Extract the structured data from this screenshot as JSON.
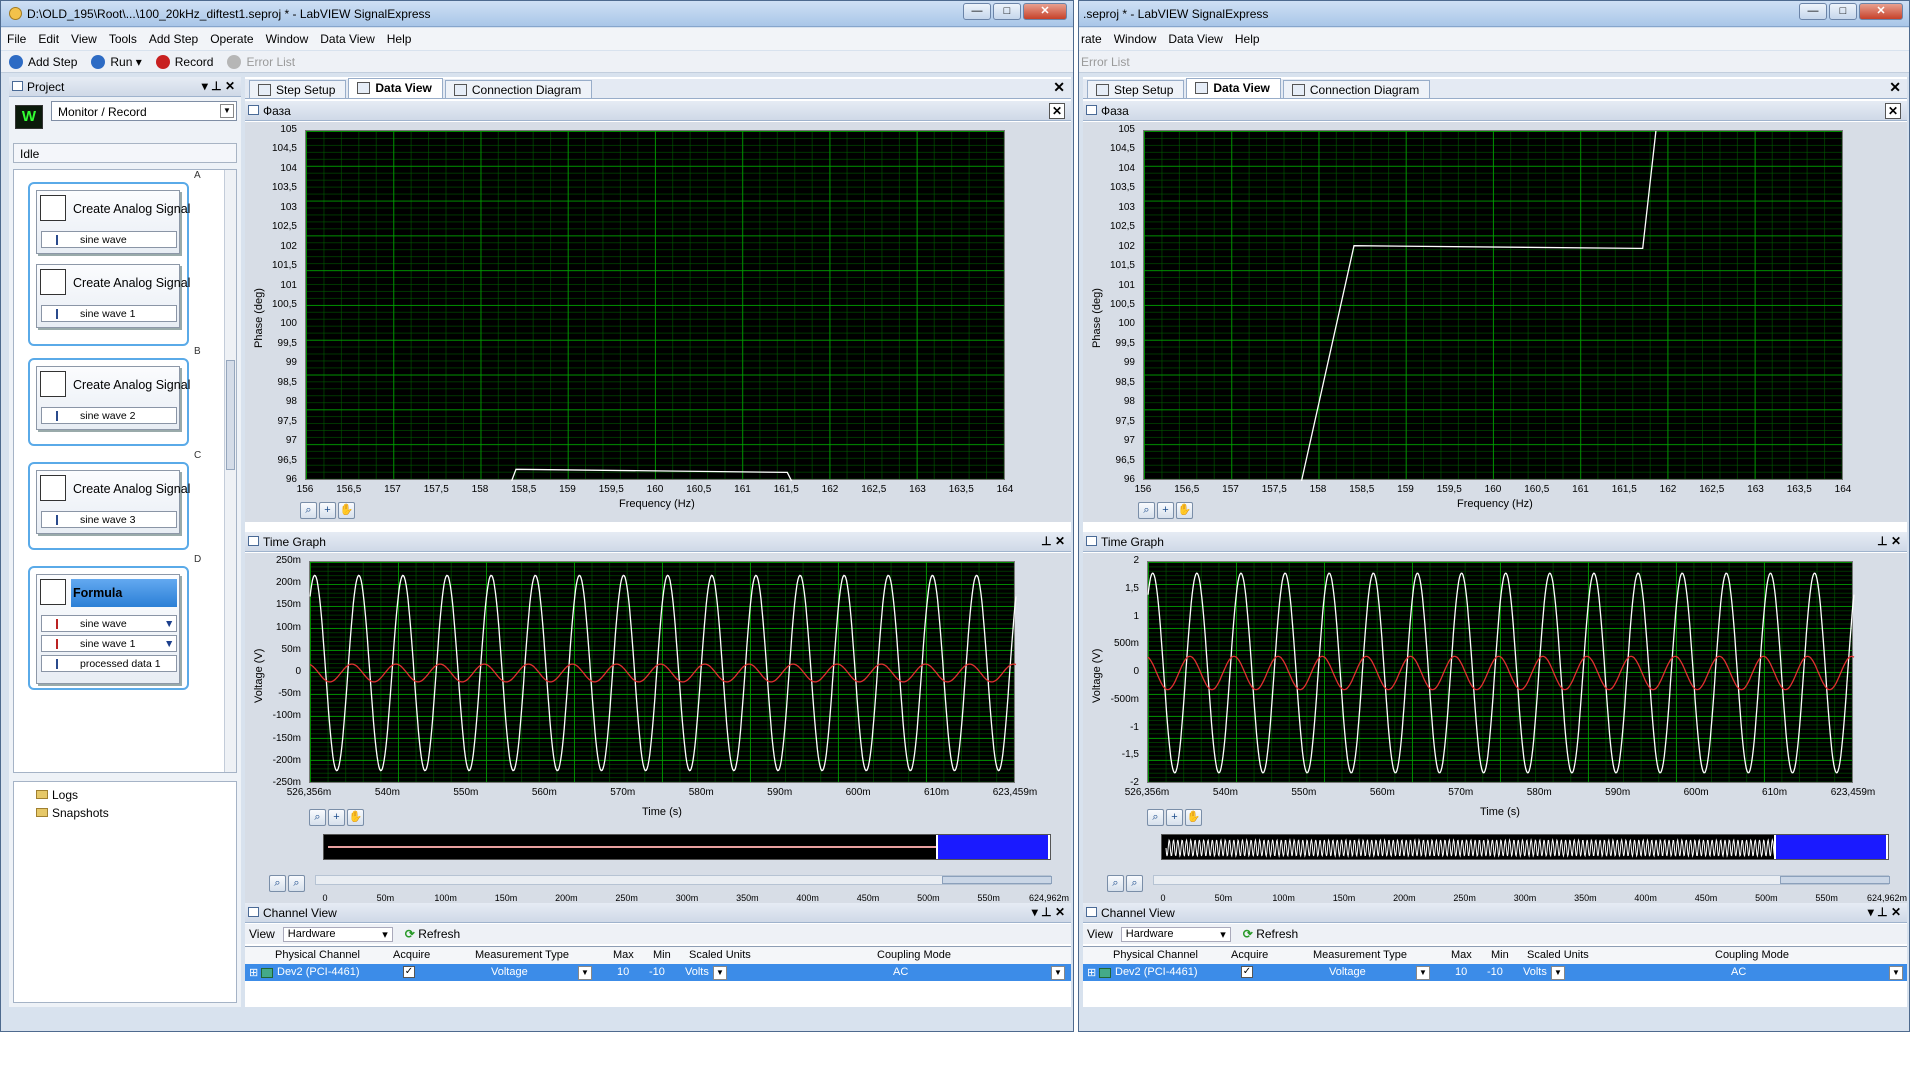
{
  "left": {
    "title": "D:\\OLD_195\\Root\\...\\100_20kHz_diftest1.seproj * - LabVIEW SignalExpress",
    "menu": [
      "File",
      "Edit",
      "View",
      "Tools",
      "Add Step",
      "Operate",
      "Window",
      "Data View",
      "Help"
    ],
    "toolbar": {
      "add_step": "Add Step",
      "run": "Run",
      "record": "Record",
      "error_list": "Error List"
    },
    "project": {
      "title": "Project",
      "mode": "Monitor / Record",
      "status": "Idle",
      "group_labels": [
        "A",
        "B",
        "C",
        "D"
      ],
      "steps": [
        {
          "title": "Create Analog Signal",
          "io": "sine wave"
        },
        {
          "title": "Create Analog Signal",
          "io": "sine wave 1"
        },
        {
          "title": "Create Analog Signal",
          "io": "sine wave 2"
        },
        {
          "title": "Create Analog Signal",
          "io": "sine wave 3"
        }
      ],
      "formula": {
        "title": "Formula",
        "inputs": [
          "sine wave",
          "sine wave 1"
        ],
        "output": "processed data 1"
      },
      "tree": [
        "Logs",
        "Snapshots"
      ]
    },
    "tabs": [
      "Step Setup",
      "Data View",
      "Connection Diagram"
    ]
  },
  "right": {
    "title": ".seproj * - LabVIEW SignalExpress",
    "menu": [
      "rate",
      "Window",
      "Data View",
      "Help"
    ],
    "toolbar": {
      "error_list": "Error List"
    },
    "tabs": [
      "Step Setup",
      "Data View",
      "Connection Diagram"
    ]
  },
  "phase_graph": {
    "title": "Фаза",
    "ylabel": "Phase (deg)",
    "xlabel": "Frequency (Hz)",
    "yticks": [
      "105",
      "104,5",
      "104",
      "103,5",
      "103",
      "102,5",
      "102",
      "101,5",
      "101",
      "100,5",
      "100",
      "99,5",
      "99",
      "98,5",
      "98",
      "97,5",
      "97",
      "96,5",
      "96"
    ],
    "xticks": [
      "156",
      "156,5",
      "157",
      "157,5",
      "158",
      "158,5",
      "159",
      "159,5",
      "160",
      "160,5",
      "161",
      "161,5",
      "162",
      "162,5",
      "163",
      "163,5",
      "164"
    ]
  },
  "time_graph": {
    "title": "Time Graph",
    "ylabel": "Voltage (V)",
    "xlabel": "Time (s)",
    "left_yticks": [
      "250m",
      "200m",
      "150m",
      "100m",
      "50m",
      "0",
      "-50m",
      "-100m",
      "-150m",
      "-200m",
      "-250m"
    ],
    "right_yticks": [
      "2",
      "1,5",
      "1",
      "500m",
      "0",
      "-500m",
      "-1",
      "-1,5",
      "-2"
    ],
    "xticks": [
      "526,356m",
      "540m",
      "550m",
      "560m",
      "570m",
      "580m",
      "590m",
      "600m",
      "610m",
      "623,459m"
    ],
    "overview_ticks": [
      "0",
      "50m",
      "100m",
      "150m",
      "200m",
      "250m",
      "300m",
      "350m",
      "400m",
      "450m",
      "500m",
      "550m",
      "624,962m"
    ]
  },
  "channel_view": {
    "title": "Channel View",
    "view_label": "View",
    "view_value": "Hardware",
    "refresh": "Refresh",
    "headers": [
      "Physical Channel",
      "Acquire",
      "Measurement Type",
      "Max",
      "Min",
      "Scaled Units",
      "Coupling Mode"
    ],
    "row": {
      "channel": "Dev2 (PCI-4461)",
      "acquire": "✓",
      "type": "Voltage",
      "max": "10",
      "min": "-10",
      "units": "Volts",
      "coupling": "AC"
    }
  },
  "chart_data": [
    {
      "type": "line",
      "title": "Фаза",
      "xlabel": "Frequency (Hz)",
      "ylabel": "Phase (deg)",
      "xlim": [
        156,
        164
      ],
      "ylim": [
        96,
        105
      ],
      "series": [
        {
          "x": [
            158.35,
            158.4,
            161.5,
            161.55
          ],
          "y": [
            96.0,
            96.3,
            96.22,
            96.0
          ]
        }
      ]
    },
    {
      "type": "line",
      "title": "Фаза",
      "xlabel": "Frequency (Hz)",
      "ylabel": "Phase (deg)",
      "xlim": [
        156,
        164
      ],
      "ylim": [
        96,
        105
      ],
      "series": [
        {
          "x": [
            157.8,
            158.4,
            161.65,
            161.7,
            161.85
          ],
          "y": [
            96.0,
            102.05,
            101.98,
            101.98,
            105.0
          ]
        }
      ]
    },
    {
      "type": "line",
      "title": "Time Graph",
      "xlabel": "Time (s)",
      "ylabel": "Voltage (V)",
      "xlim": [
        0.526356,
        0.623459
      ],
      "ylim": [
        -0.25,
        0.25
      ],
      "series": [
        {
          "color": "#ffffff",
          "amplitude": 0.22,
          "cycles": 16
        },
        {
          "color": "#e03030",
          "amplitude": 0.02,
          "cycles": 16
        }
      ]
    },
    {
      "type": "line",
      "title": "Time Graph",
      "xlabel": "Time (s)",
      "ylabel": "Voltage (V)",
      "xlim": [
        0.526356,
        0.623459
      ],
      "ylim": [
        -2,
        2
      ],
      "series": [
        {
          "color": "#ffffff",
          "amplitude": 1.8,
          "cycles": 16
        },
        {
          "color": "#e03030",
          "amplitude": 0.3,
          "cycles": 16
        }
      ]
    }
  ]
}
